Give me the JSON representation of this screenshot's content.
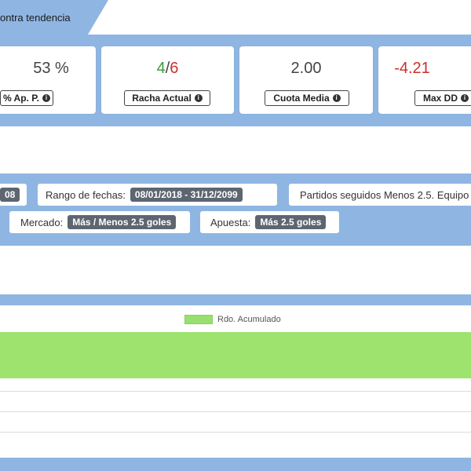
{
  "tab": {
    "title": "ontra tendencia"
  },
  "stats": [
    {
      "value": "53 %",
      "label": "% Ap. P."
    },
    {
      "value_parts": [
        "4",
        "/",
        "6"
      ],
      "label": "Racha Actual"
    },
    {
      "value": "2.00",
      "label": "Cuota Media"
    },
    {
      "value": "-4.21",
      "label": "Max DD"
    }
  ],
  "filters": {
    "partial_value": "08",
    "date_range": {
      "label": "Rango de fechas:",
      "value": "08/01/2018 - 31/12/2099"
    },
    "partidos": {
      "label": "Partidos seguidos Menos 2.5. Equipo"
    },
    "mercado": {
      "label": "Mercado:",
      "value": "Más / Menos 2.5 goles"
    },
    "apuesta": {
      "label": "Apuesta:",
      "value": "Más 2.5 goles"
    }
  },
  "chart": {
    "legend": "Rdo. Acumulado",
    "series_color": "#9de36e"
  },
  "colors": {
    "band": "#8fb6e2",
    "positive": "#3c9a3c",
    "negative": "#c9302c",
    "pill": "#5d6670"
  },
  "icons": {
    "info": "info-icon"
  }
}
